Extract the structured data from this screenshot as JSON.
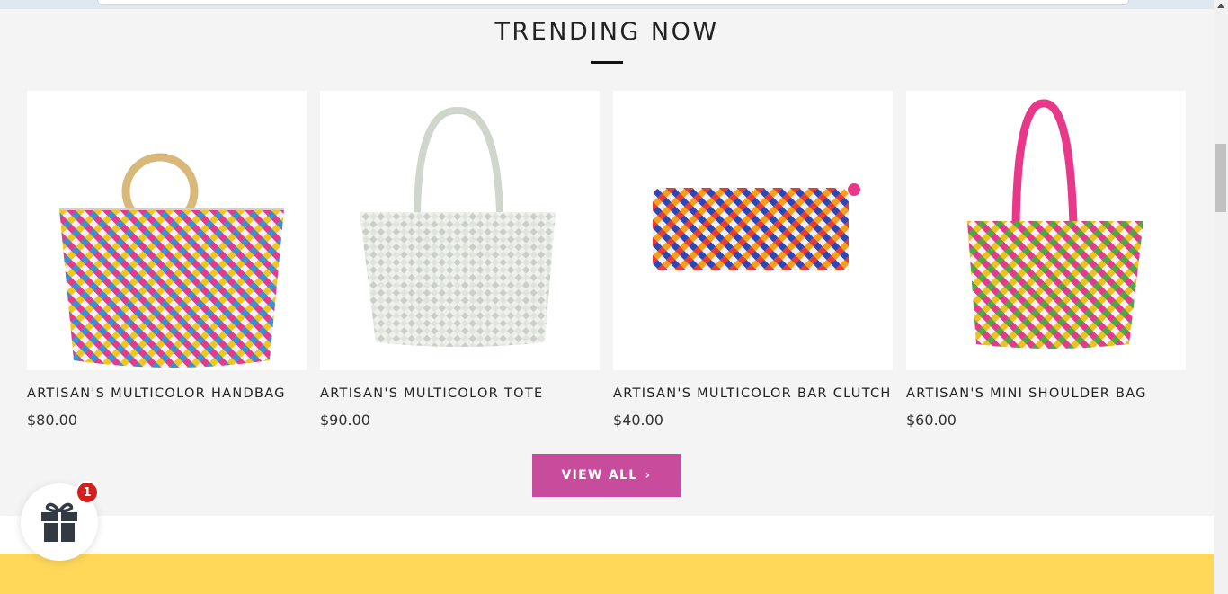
{
  "section": {
    "title": "TRENDING NOW",
    "view_all_label": "VIEW ALL"
  },
  "products": [
    {
      "name": "ARTISAN'S MULTICOLOR HANDBAG",
      "price": "$80.00",
      "image": "handbag-image"
    },
    {
      "name": "ARTISAN'S MULTICOLOR TOTE",
      "price": "$90.00",
      "image": "tote-image"
    },
    {
      "name": "ARTISAN'S MULTICOLOR BAR CLUTCH",
      "price": "$40.00",
      "image": "clutch-image"
    },
    {
      "name": "ARTISAN'S MINI SHOULDER BAG",
      "price": "$60.00",
      "image": "shoulder-bag-image"
    }
  ],
  "gift_widget": {
    "badge_count": "1",
    "icon": "gift-icon"
  },
  "colors": {
    "accent": "#c84b9c",
    "section_bg": "#f4f4f4",
    "footer_band": "#ffd85a",
    "badge": "#d41d1d"
  }
}
